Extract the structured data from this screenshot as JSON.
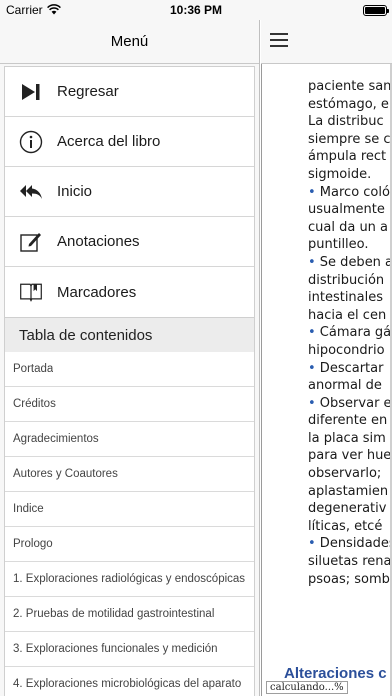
{
  "status_bar": {
    "carrier": "Carrier",
    "time": "10:36 PM",
    "battery_level": 1.0
  },
  "sidebar": {
    "title": "Menú",
    "menu_items": [
      {
        "label": "Regresar",
        "icon": "skip-forward-icon"
      },
      {
        "label": "Acerca del libro",
        "icon": "info-icon"
      },
      {
        "label": "Inicio",
        "icon": "reply-all-icon"
      },
      {
        "label": "Anotaciones",
        "icon": "edit-icon"
      },
      {
        "label": "Marcadores",
        "icon": "book-icon"
      }
    ],
    "toc_title": "Tabla de contenidos",
    "toc_items": [
      "Portada",
      "Créditos",
      "Agradecimientos",
      "Autores y Coautores",
      "Índice",
      "Prologo",
      "1. Exploraciones radiológicas y endoscópicas",
      "2. Pruebas de motilidad gastrointestinal",
      "3. Exploraciones funcionales y medición",
      "4. Exploraciones microbiológicas del aparato"
    ]
  },
  "reader": {
    "menu_icon": "hamburger-icon",
    "text_lines": [
      "paciente san",
      "estómago, e",
      "La distribuc",
      "siempre se c",
      "ámpula rect",
      "sigmoide.",
      "• Marco coló",
      "usualmente",
      "cual da un a",
      "puntilleo.",
      "• Se deben a",
      "distribución",
      "intestinales",
      "hacia el cen",
      "• Cámara gá",
      "hipocondrio",
      "• Descartar",
      "anormal de",
      "• Observar e",
      "diferente en",
      "la placa sim",
      "para ver hue",
      "observarlo;",
      "aplastamien",
      "degenerativ",
      "líticas, etcé",
      "• Densidades",
      "siluetas rena",
      "psoas; somb"
    ],
    "section_heading": "Alteraciones c",
    "status_text": "calculando...%",
    "accent_color": "#2b4f9a"
  }
}
